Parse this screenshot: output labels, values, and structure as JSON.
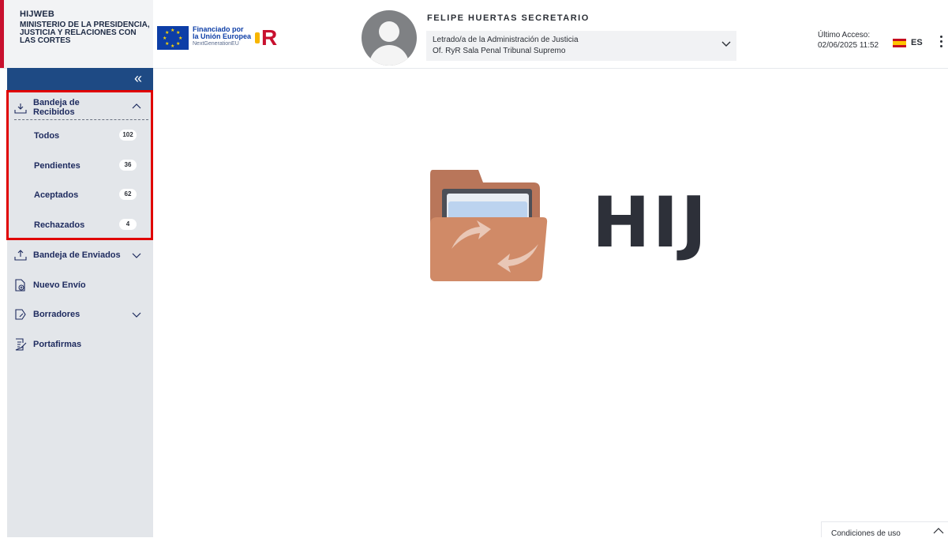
{
  "brand": {
    "app_name": "HIJWEB",
    "ministry": "MINISTERIO DE LA PRESIDENCIA, JUSTICIA Y RELACIONES CON LAS CORTES"
  },
  "eu_logo": {
    "line1": "Financiado por",
    "line2": "la Unión Europea",
    "line3": "NextGenerationEU"
  },
  "tr_logo": {
    "text": "R"
  },
  "user": {
    "name": "FELIPE HUERTAS SECRETARIO",
    "role_line1": "Letrado/a de la Administración de Justicia",
    "role_line2": "Of. RyR Sala Penal Tribunal Supremo"
  },
  "last_access": {
    "label": "Último Acceso:",
    "value": "02/06/2025 11:52"
  },
  "language": {
    "code": "ES"
  },
  "sidebar": {
    "inbox": {
      "label": "Bandeja de Recibidos",
      "items": [
        {
          "label": "Todos",
          "count": "102"
        },
        {
          "label": "Pendientes",
          "count": "36"
        },
        {
          "label": "Aceptados",
          "count": "62"
        },
        {
          "label": "Rechazados",
          "count": "4"
        }
      ]
    },
    "sent": {
      "label": "Bandeja de Enviados"
    },
    "new_send": {
      "label": "Nuevo Envío"
    },
    "drafts": {
      "label": "Borradores"
    },
    "signatures": {
      "label": "Portafirmas"
    }
  },
  "main": {
    "logo_text": "HIJ"
  },
  "footer": {
    "terms_label": "Condiciones de uso"
  },
  "colors": {
    "sidebar_top": "#1e4a84",
    "highlight": "#e00000",
    "folder": "#d08a67",
    "folder_back": "#b9765a",
    "logo_text": "#2d3039"
  }
}
